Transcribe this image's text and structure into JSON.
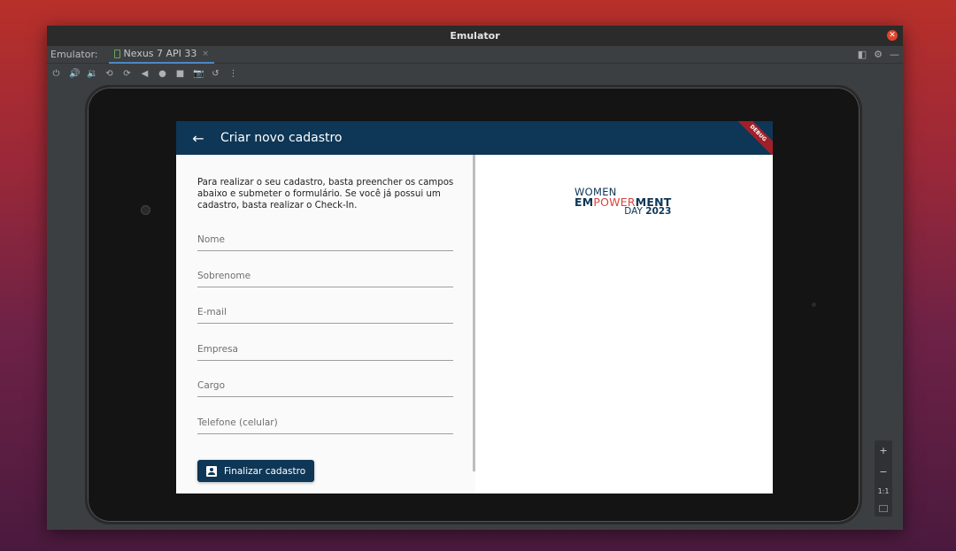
{
  "window": {
    "title": "Emulator"
  },
  "tabbar": {
    "label": "Emulator:",
    "device_tab": "Nexus 7 API 33",
    "tab_close": "×"
  },
  "toolbar": {
    "icons": [
      "power-icon",
      "volume-up-icon",
      "volume-down-icon",
      "rotate-left-icon",
      "rotate-right-icon",
      "back-icon",
      "home-icon",
      "overview-icon",
      "screenshot-icon",
      "snapshot-icon",
      "more-icon"
    ]
  },
  "app": {
    "title": "Criar novo cadastro",
    "debug_banner": "DEBUG",
    "intro": "Para realizar o seu cadastro, basta preencher os campos abaixo e submeter o formulário. Se você já possui um cadastro, basta realizar o Check-In.",
    "fields": [
      "Nome",
      "Sobrenome",
      "E-mail",
      "Empresa",
      "Cargo",
      "Telefone (celular)"
    ],
    "submit_label": "Finalizar cadastro",
    "logo": {
      "line1": "WOMEN",
      "line2_a": "EM",
      "line2_b": "POWER",
      "line2_c": "MENT",
      "line3_a": "DAY ",
      "line3_b": "2023"
    },
    "accent_color": "#0e3656"
  },
  "zoom": {
    "zoom_in": "+",
    "zoom_out": "−",
    "actual_size": "1:1"
  }
}
